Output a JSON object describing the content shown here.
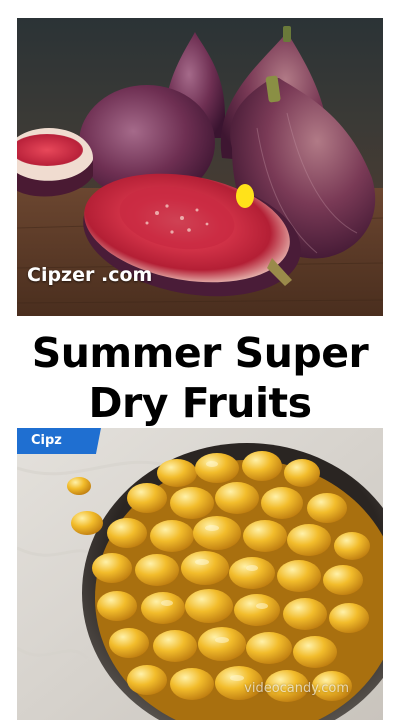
{
  "top_image": {
    "watermark": "Cipzer .com"
  },
  "headline": {
    "line1": "Summer Super",
    "line2": "Dry Fruits"
  },
  "bottom_image": {
    "badge": "Cipz",
    "watermark": "videocandy.com"
  },
  "colors": {
    "badge": "#1f6fd1",
    "headline_text": "#000000",
    "background": "#ffffff"
  }
}
